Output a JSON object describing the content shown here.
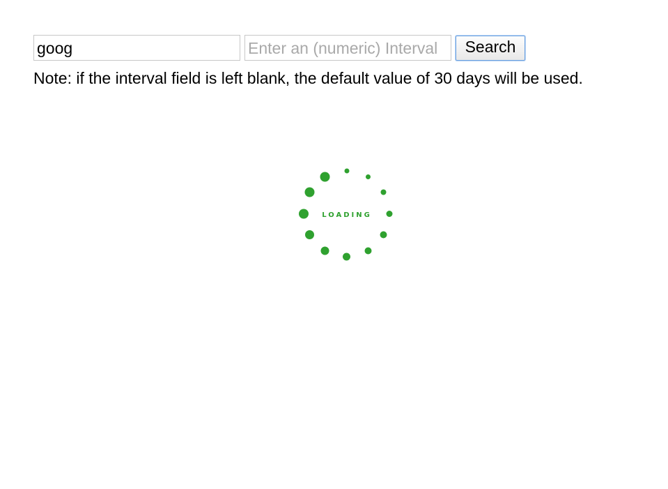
{
  "search": {
    "ticker_value": "goog",
    "interval_value": "",
    "interval_placeholder": "Enter an (numeric) Interval",
    "button_label": "Search"
  },
  "note": "Note: if the interval field is left blank, the default value of 30 days will be used.",
  "loader": {
    "label": "LOADING",
    "icon": "loading-spinner-icon",
    "color": "#2fa12f"
  }
}
